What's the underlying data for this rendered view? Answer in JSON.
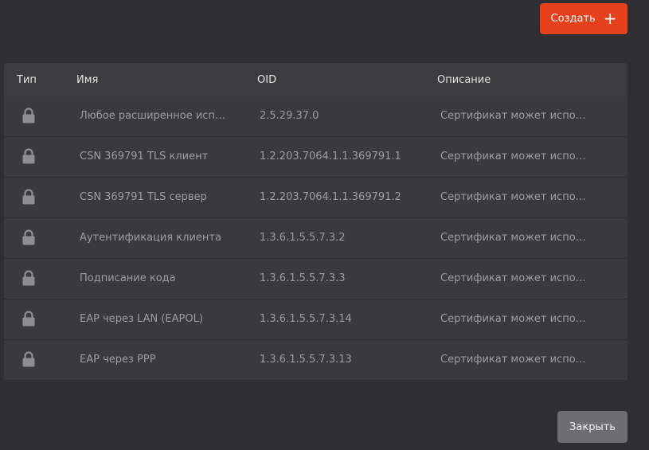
{
  "toolbar": {
    "create_label": "Создать",
    "create_icon": "plus-icon",
    "accent_color": "#e6401c"
  },
  "table": {
    "headers": {
      "type": "Тип",
      "name": "Имя",
      "oid": "OID",
      "description": "Описание"
    },
    "rows": [
      {
        "type_icon": "lock-icon",
        "name": "Любое расширенное исп…",
        "oid": "2.5.29.37.0",
        "description": "Сертификат может испо…"
      },
      {
        "type_icon": "lock-icon",
        "name": "CSN 369791 TLS клиент",
        "oid": "1.2.203.7064.1.1.369791.1",
        "description": "Сертификат может испо…"
      },
      {
        "type_icon": "lock-icon",
        "name": "CSN 369791 TLS сервер",
        "oid": "1.2.203.7064.1.1.369791.2",
        "description": "Сертификат может испо…"
      },
      {
        "type_icon": "lock-icon",
        "name": "Аутентификация клиента",
        "oid": "1.3.6.1.5.5.7.3.2",
        "description": "Сертификат может испо…"
      },
      {
        "type_icon": "lock-icon",
        "name": "Подписание кода",
        "oid": "1.3.6.1.5.5.7.3.3",
        "description": "Сертификат может испо…"
      },
      {
        "type_icon": "lock-icon",
        "name": "EAP через LAN (EAPOL)",
        "oid": "1.3.6.1.5.5.7.3.14",
        "description": "Сертификат может испо…"
      },
      {
        "type_icon": "lock-icon",
        "name": "EAP через PPP",
        "oid": "1.3.6.1.5.5.7.3.13",
        "description": "Сертификат может испо…"
      }
    ]
  },
  "footer": {
    "close_label": "Закрыть"
  }
}
